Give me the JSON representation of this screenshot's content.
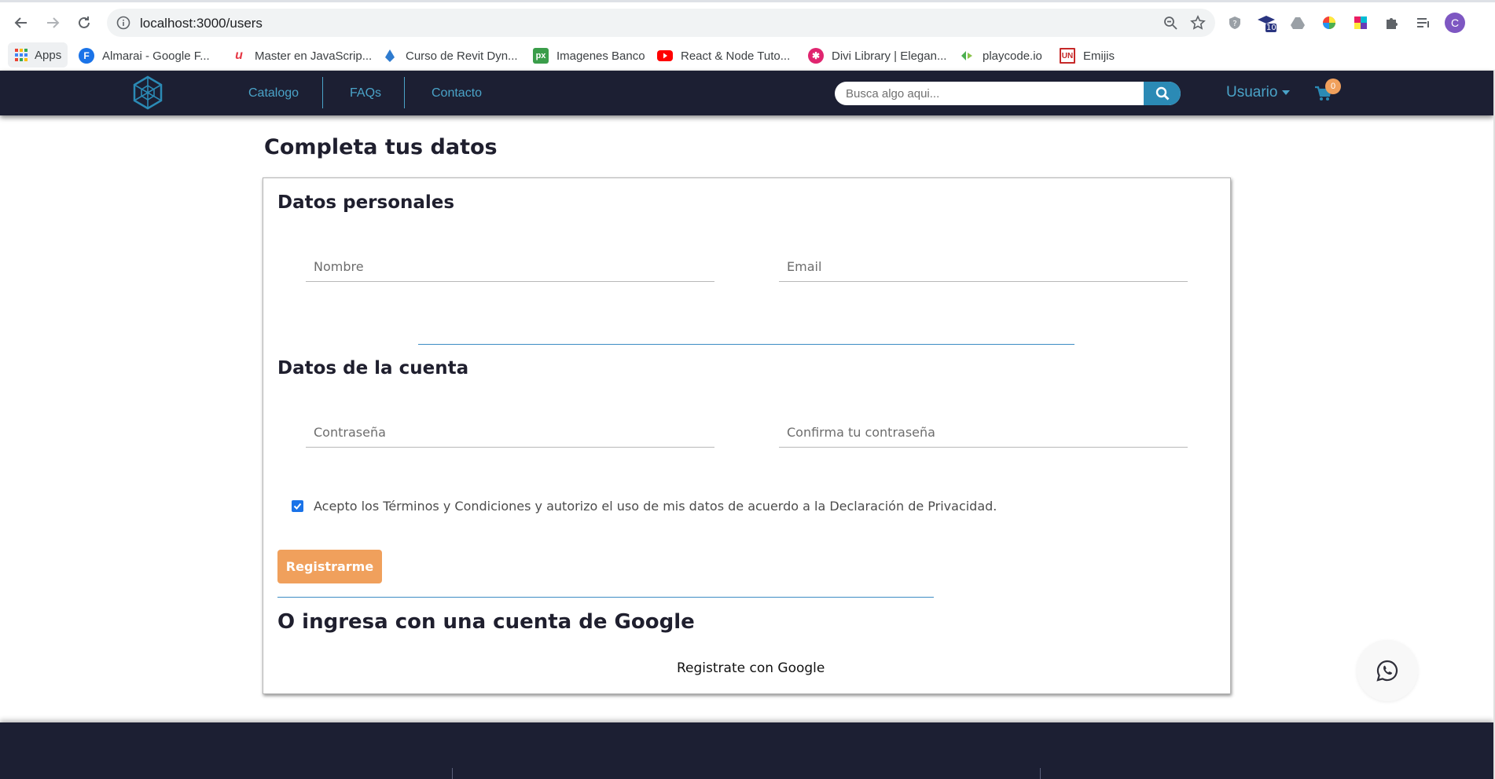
{
  "browser": {
    "url": "localhost:3000/users",
    "extension_badge": "10",
    "profile_initial": "C",
    "bookmarks": [
      {
        "label": "Apps",
        "icon": "apps-grid-icon"
      },
      {
        "label": "Almarai - Google F...",
        "icon": "google-fonts-icon",
        "color": "#1a73e8"
      },
      {
        "label": "Master en JavaScrip...",
        "icon": "udemy-icon",
        "color": "#e63946"
      },
      {
        "label": "Curso de Revit Dyn...",
        "icon": "dynamo-icon",
        "color": "#2e7bcf"
      },
      {
        "label": "Imagenes Banco",
        "icon": "pexels-icon",
        "color": "#3a9d4a"
      },
      {
        "label": "React & Node Tuto...",
        "icon": "youtube-icon",
        "color": "#ff0000"
      },
      {
        "label": "Divi Library | Elegan...",
        "icon": "divi-icon",
        "color": "#e0256f"
      },
      {
        "label": "playcode.io",
        "icon": "playcode-icon",
        "color": "#4caf50"
      },
      {
        "label": "Emijis",
        "icon": "unicode-icon",
        "color": "#c62828"
      }
    ]
  },
  "navbar": {
    "links": [
      "Catalogo",
      "FAQs",
      "Contacto"
    ],
    "search_placeholder": "Busca algo aqui...",
    "user_label": "Usuario",
    "cart_count": "0",
    "colors": {
      "background": "#1c1f33",
      "accent": "#4aa3c8"
    }
  },
  "page": {
    "title": "Completa tus datos",
    "personal": {
      "heading": "Datos personales",
      "name_placeholder": "Nombre",
      "email_placeholder": "Email"
    },
    "account": {
      "heading": "Datos de la cuenta",
      "password_placeholder": "Contraseña",
      "confirm_placeholder": "Confirma tu contraseña"
    },
    "terms_text": "Acepto los Términos y Condiciones y autorizo el uso de mis datos de acuerdo a la Declaración de Privacidad.",
    "terms_checked": true,
    "register_button": "Registrarme",
    "google_heading": "O ingresa con una cuenta de Google",
    "google_button": "Registrate con Google",
    "colors": {
      "button": "#f0a05c",
      "divider": "#3c8cc4"
    }
  }
}
